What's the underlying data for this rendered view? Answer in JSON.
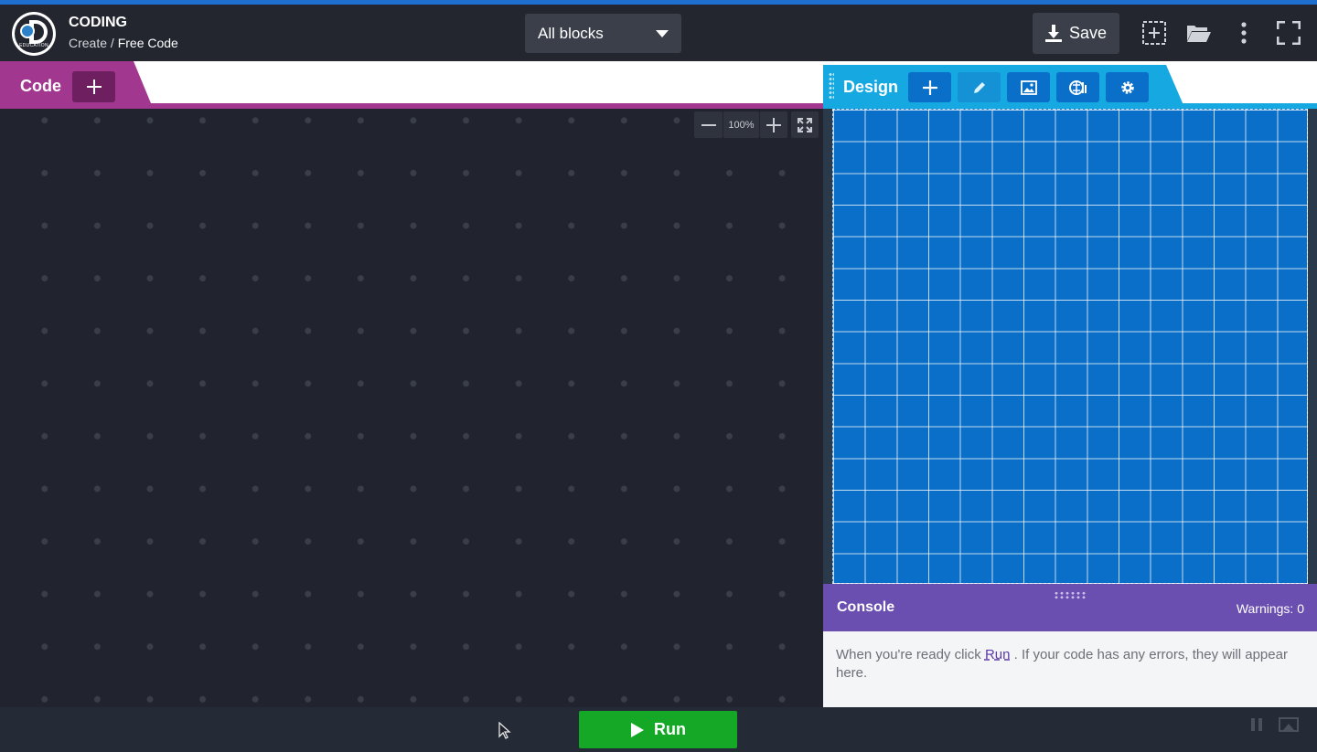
{
  "header": {
    "app_title": "CODING",
    "breadcrumb_parent": "Create /",
    "breadcrumb_current": "Free Code",
    "logo_text": "EDUCATION",
    "block_filter": "All blocks",
    "save_label": "Save"
  },
  "code_panel": {
    "tab_label": "Code",
    "zoom_level": "100%"
  },
  "design_panel": {
    "tab_label": "Design"
  },
  "console": {
    "title": "Console",
    "warnings": "Warnings: 0",
    "message_before": "When you're ready click",
    "message_link": "Run",
    "message_after": ". If your code has any errors, they will appear here."
  },
  "bottom": {
    "run_label": "Run"
  },
  "colors": {
    "code_accent": "#a2378f",
    "design_accent": "#16a8e0",
    "stage_blue": "#0a6fc8",
    "console_purple": "#6a4fb0",
    "run_green": "#15a826"
  },
  "icons": [
    "add-file-icon",
    "folder-open-icon",
    "more-vertical-icon",
    "fullscreen-icon",
    "download-icon",
    "pencil-icon",
    "image-icon",
    "sprite-icon",
    "gear-icon",
    "play-icon",
    "pause-icon",
    "stage-view-icon"
  ]
}
